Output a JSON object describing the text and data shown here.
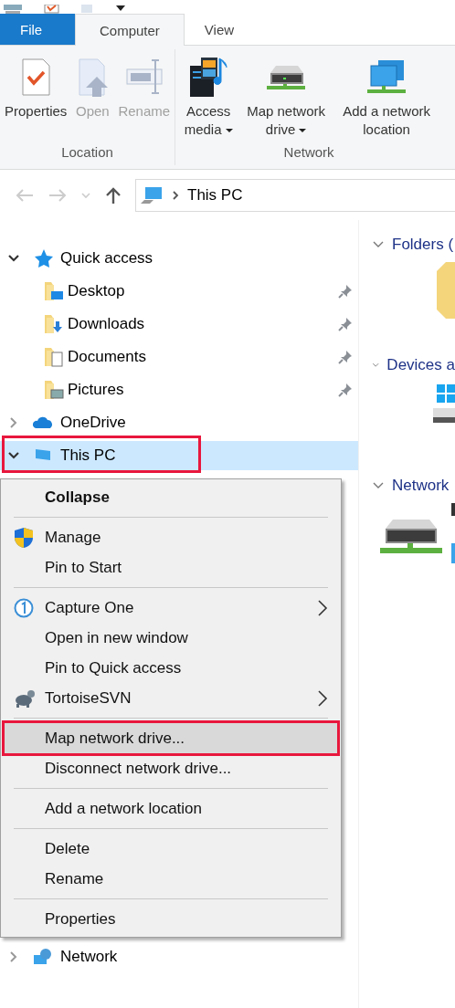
{
  "ribbon": {
    "tabs": [
      {
        "label": "File",
        "kind": "file",
        "selected": false
      },
      {
        "label": "Computer",
        "kind": "tab",
        "selected": true
      },
      {
        "label": "View",
        "kind": "tab",
        "selected": false
      }
    ],
    "groups": [
      {
        "label": "Location",
        "commands": [
          {
            "label": "Properties",
            "disabled": false,
            "dropdown": false
          },
          {
            "label": "Open",
            "disabled": true,
            "dropdown": false
          },
          {
            "label": "Rename",
            "disabled": true,
            "dropdown": false
          }
        ]
      },
      {
        "label": "Network",
        "commands": [
          {
            "label": "Access media",
            "disabled": false,
            "dropdown": true
          },
          {
            "label": "Map network drive",
            "disabled": false,
            "dropdown": true
          },
          {
            "label": "Add a network location",
            "disabled": false,
            "dropdown": false
          }
        ]
      }
    ]
  },
  "address": {
    "path": "This PC"
  },
  "nav": {
    "items": [
      {
        "label": "Quick access",
        "expanded": true,
        "selected": false,
        "annotated": false,
        "children": [
          {
            "label": "Desktop",
            "pinned": true
          },
          {
            "label": "Downloads",
            "pinned": true
          },
          {
            "label": "Documents",
            "pinned": true
          },
          {
            "label": "Pictures",
            "pinned": true
          }
        ]
      },
      {
        "label": "OneDrive",
        "expanded": false,
        "selected": false,
        "annotated": false
      },
      {
        "label": "This PC",
        "expanded": true,
        "selected": true,
        "annotated": true
      },
      {
        "label": "Network",
        "expanded": false,
        "selected": false,
        "annotated": false
      }
    ]
  },
  "content": {
    "sections": [
      {
        "label": "Folders ("
      },
      {
        "label": "Devices a"
      },
      {
        "label": "Network"
      }
    ]
  },
  "context_menu": {
    "items": [
      {
        "kind": "item",
        "label": "Collapse",
        "bold": true,
        "submenu": false,
        "hovered": false,
        "annotated": false
      },
      {
        "kind": "separator"
      },
      {
        "kind": "item",
        "label": "Manage",
        "bold": false,
        "submenu": false,
        "hovered": false,
        "annotated": false
      },
      {
        "kind": "item",
        "label": "Pin to Start",
        "bold": false,
        "submenu": false,
        "hovered": false,
        "annotated": false
      },
      {
        "kind": "separator"
      },
      {
        "kind": "item",
        "label": "Capture One",
        "bold": false,
        "submenu": true,
        "hovered": false,
        "annotated": false
      },
      {
        "kind": "item",
        "label": "Open in new window",
        "bold": false,
        "submenu": false,
        "hovered": false,
        "annotated": false
      },
      {
        "kind": "item",
        "label": "Pin to Quick access",
        "bold": false,
        "submenu": false,
        "hovered": false,
        "annotated": false
      },
      {
        "kind": "item",
        "label": "TortoiseSVN",
        "bold": false,
        "submenu": true,
        "hovered": false,
        "annotated": false
      },
      {
        "kind": "separator"
      },
      {
        "kind": "item",
        "label": "Map network drive...",
        "bold": false,
        "submenu": false,
        "hovered": true,
        "annotated": true
      },
      {
        "kind": "item",
        "label": "Disconnect network drive...",
        "bold": false,
        "submenu": false,
        "hovered": false,
        "annotated": false
      },
      {
        "kind": "separator"
      },
      {
        "kind": "item",
        "label": "Add a network location",
        "bold": false,
        "submenu": false,
        "hovered": false,
        "annotated": false
      },
      {
        "kind": "separator"
      },
      {
        "kind": "item",
        "label": "Delete",
        "bold": false,
        "submenu": false,
        "hovered": false,
        "annotated": false
      },
      {
        "kind": "item",
        "label": "Rename",
        "bold": false,
        "submenu": false,
        "hovered": false,
        "annotated": false
      },
      {
        "kind": "separator"
      },
      {
        "kind": "item",
        "label": "Properties",
        "bold": false,
        "submenu": false,
        "hovered": false,
        "annotated": false
      }
    ]
  }
}
